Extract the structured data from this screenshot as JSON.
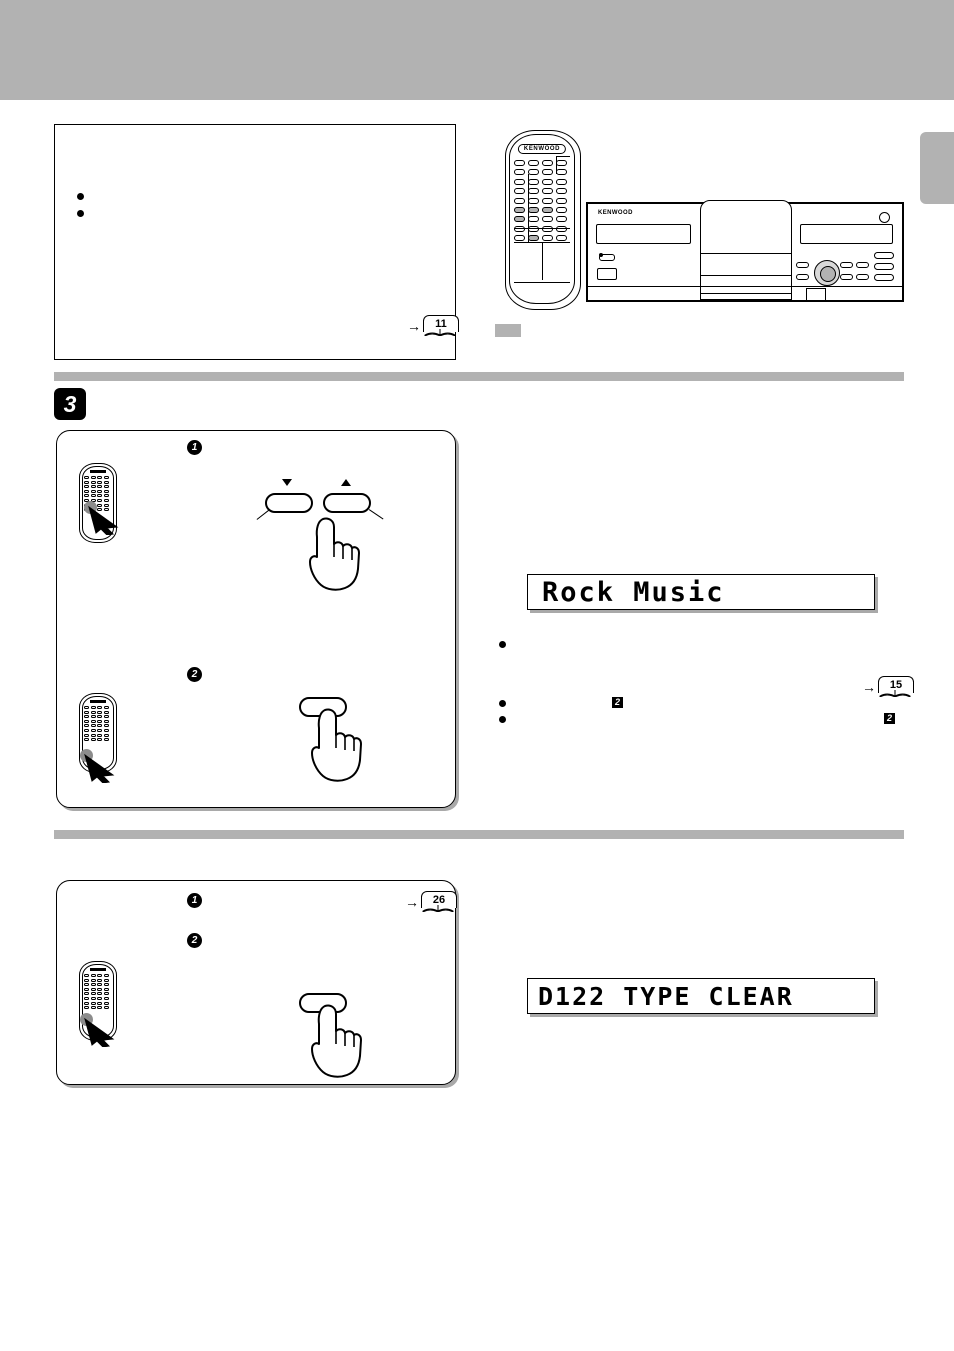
{
  "page": {
    "brand": "KENWOOD",
    "header_band_color": "#b2b2b2",
    "side_tab_color": "#b2b2b2"
  },
  "note_box": {
    "bullets": [
      "",
      ""
    ],
    "page_ref": {
      "arrow": "→",
      "page": "11"
    }
  },
  "hardware": {
    "remote_brand": "KENWOOD",
    "unit_brand": "KENWOOD",
    "caption_chip": ""
  },
  "step3": {
    "badge": "3",
    "substeps": [
      {
        "marker": "1"
      },
      {
        "marker": "2"
      }
    ],
    "buttons": {
      "down_label": "▼",
      "up_label": "▲"
    }
  },
  "display_1": {
    "text": "Rock Music"
  },
  "display_2": {
    "text": "D122 TYPE CLEAR"
  },
  "notes_right": {
    "bullets": [
      "",
      "",
      ""
    ],
    "page_ref": {
      "arrow": "→",
      "page": "15"
    },
    "square_markers": [
      "2",
      "2"
    ]
  },
  "clear_panel": {
    "substeps": [
      {
        "marker": "1"
      },
      {
        "marker": "2"
      }
    ],
    "page_ref": {
      "arrow": "→",
      "page": "26"
    }
  }
}
